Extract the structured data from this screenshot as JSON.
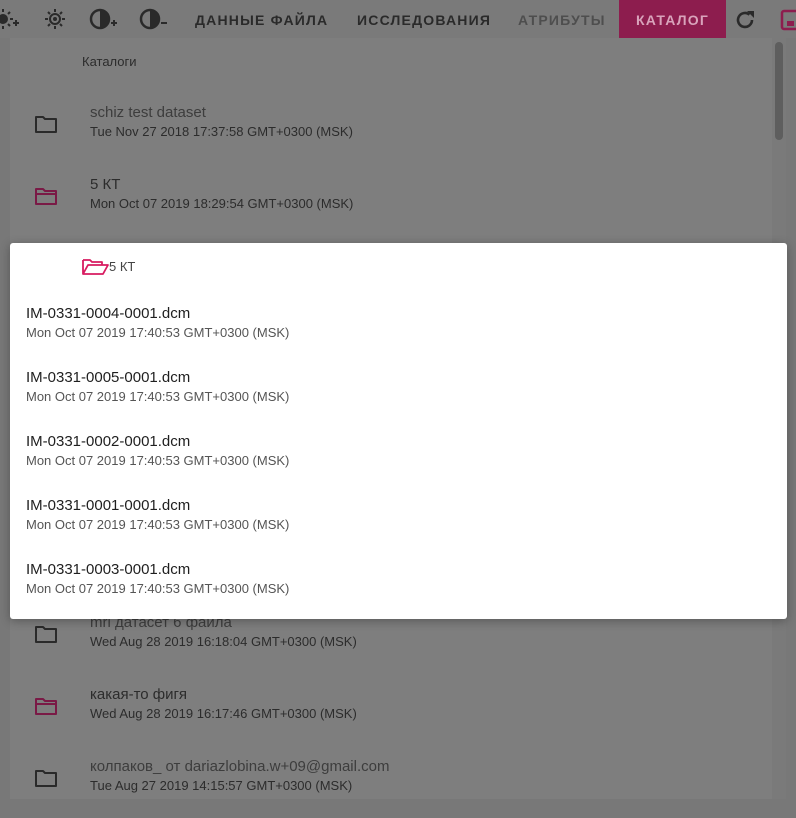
{
  "colors": {
    "accent": "#d81b60",
    "toolbar": "#7a7a7a",
    "overlay": "#7e7e7e"
  },
  "toolbar": {
    "icons": [
      "brightness-up-icon",
      "brightness-icon",
      "contrast-up-icon",
      "contrast-down-icon",
      "refresh-icon",
      "save-icon"
    ],
    "tabs": [
      {
        "label": "ДАННЫЕ ФАЙЛА",
        "state": "normal"
      },
      {
        "label": "ИССЛЕДОВАНИЯ",
        "state": "normal"
      },
      {
        "label": "АТРИБУТЫ",
        "state": "disabled"
      },
      {
        "label": "КАТАЛОГ",
        "state": "active"
      }
    ]
  },
  "catalog": {
    "title": "Каталоги",
    "items": [
      {
        "name": "schiz test dataset",
        "date": "Tue Nov 27 2018 17:37:58 GMT+0300 (MSK)",
        "icon": "folder-icon"
      },
      {
        "name": "5 КТ",
        "date": "Mon Oct 07 2019 18:29:54 GMT+0300 (MSK)",
        "icon": "folder-icon"
      },
      {
        "name": "mri датасет 6 файла",
        "date": "Wed Aug 28 2019 16:18:04 GMT+0300 (MSK)",
        "icon": "folder-icon"
      },
      {
        "name": "какая-то фигя",
        "date": "Wed Aug 28 2019 16:17:46 GMT+0300 (MSK)",
        "icon": "folder-icon"
      },
      {
        "name": "колпаков_ от dariazlobina.w+09@gmail.com",
        "date": "Tue Aug 27 2019 14:15:57 GMT+0300 (MSK)",
        "icon": "folder-icon"
      }
    ]
  },
  "popup": {
    "folder_name": "5 КТ",
    "icon": "folder-open-icon",
    "files": [
      {
        "name": "IM-0331-0004-0001.dcm",
        "date": "Mon Oct 07 2019 17:40:53 GMT+0300 (MSK)"
      },
      {
        "name": "IM-0331-0005-0001.dcm",
        "date": "Mon Oct 07 2019 17:40:53 GMT+0300 (MSK)"
      },
      {
        "name": "IM-0331-0002-0001.dcm",
        "date": "Mon Oct 07 2019 17:40:53 GMT+0300 (MSK)"
      },
      {
        "name": "IM-0331-0001-0001.dcm",
        "date": "Mon Oct 07 2019 17:40:53 GMT+0300 (MSK)"
      },
      {
        "name": "IM-0331-0003-0001.dcm",
        "date": "Mon Oct 07 2019 17:40:53 GMT+0300 (MSK)"
      }
    ]
  }
}
